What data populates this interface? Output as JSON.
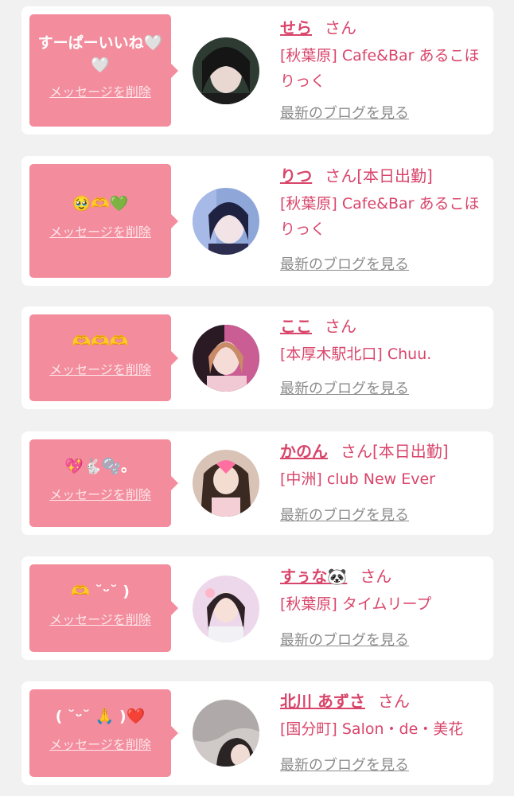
{
  "delete_label": "メッセージを削除",
  "blog_label": "最新のブログを見る",
  "suffix": "さん",
  "colors": {
    "bubble": "#f38c9c",
    "accent": "#d9456a",
    "link_gray": "#8b8b8b",
    "page_bg": "#f1f1f2"
  },
  "messages": [
    {
      "text": "すーぱーいいね🤍🤍",
      "name": "せら",
      "status": "",
      "shop": "[秋葉原] Cafe&Bar あるこほりっく"
    },
    {
      "text": "🥹🫶💚",
      "name": "りつ",
      "status": "[本日出勤]",
      "shop": "[秋葉原] Cafe&Bar あるこほりっく"
    },
    {
      "text": "🫶🫶🫶",
      "name": "ここ",
      "status": "",
      "shop": "[本厚木駅北口] Chuu."
    },
    {
      "text": "💖🐇🫧。",
      "name": "かのん",
      "status": "[本日出勤]",
      "shop": "[中洲] club New Ever"
    },
    {
      "text": "🫶 ˘ᵕ˘ )",
      "name": "すぅな🐼",
      "status": "",
      "shop": "[秋葉原] タイムリープ"
    },
    {
      "text": "( ˘ᵕ˘ 🙏 )❤️",
      "name": "北川 あずさ",
      "status": "",
      "shop": "[国分町] Salon・de・美花"
    }
  ]
}
